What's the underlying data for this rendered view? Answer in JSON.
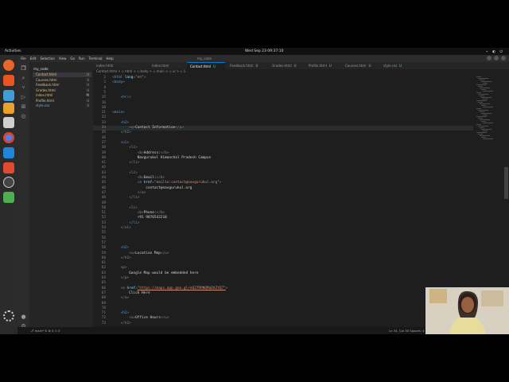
{
  "topbar": {
    "activities": "Activities",
    "clock": "Wed Sep 23  09:37:10",
    "tray": "⌁ ◐ ⏻"
  },
  "menu": [
    "File",
    "Edit",
    "Selection",
    "View",
    "Go",
    "Run",
    "Terminal",
    "Help"
  ],
  "window_title": "my_code",
  "explorer": {
    "title": "my_code",
    "files": [
      {
        "name": "Contact.html",
        "badge": "U",
        "active": true
      },
      {
        "name": "Courses.html",
        "badge": "U",
        "active": false
      },
      {
        "name": "Feedback.html",
        "badge": "U",
        "active": false
      },
      {
        "name": "Grades.html",
        "badge": "U",
        "active": false
      },
      {
        "name": "index.html",
        "badge": "M",
        "active": false
      },
      {
        "name": "Profile.html",
        "badge": "U",
        "active": false
      },
      {
        "name": "style.css",
        "badge": "U",
        "active": false
      }
    ]
  },
  "tabs": [
    {
      "label": "index.html",
      "badge": "",
      "active": false
    },
    {
      "label": "index.html",
      "badge": "",
      "active": false
    },
    {
      "label": "Contact.html",
      "badge": "U",
      "active": true
    },
    {
      "label": "Feedback.html",
      "badge": "U",
      "active": false
    },
    {
      "label": "Grades.html",
      "badge": "U",
      "active": false
    },
    {
      "label": "Profile.html",
      "badge": "U",
      "active": false
    },
    {
      "label": "Courses.html",
      "badge": "U",
      "active": false
    },
    {
      "label": "style.css",
      "badge": "U",
      "active": false
    }
  ],
  "breadcrumb": "Contact.html > ◇ html > ◇ body > ◇ main > ◇ ul > ◇ li",
  "editor": {
    "lines": [
      {
        "n": "2",
        "parts": [
          [
            "punct",
            "<"
          ],
          [
            "tag",
            "html"
          ],
          [
            "attr",
            " lang"
          ],
          [
            "punct",
            "="
          ],
          [
            "str",
            "\"en\""
          ],
          [
            "punct",
            ">"
          ]
        ]
      },
      {
        "n": "3",
        "parts": [
          [
            "punct",
            "<"
          ],
          [
            "tag",
            "body"
          ],
          [
            "punct",
            ">"
          ]
        ]
      },
      {
        "n": "4",
        "parts": []
      },
      {
        "n": "5",
        "parts": []
      },
      {
        "n": "15",
        "parts": [
          [
            "text",
            "    "
          ],
          [
            "punct",
            "<"
          ],
          [
            "tag",
            "hr"
          ],
          [
            "punct",
            "/>"
          ]
        ]
      },
      {
        "n": "16",
        "parts": []
      },
      {
        "n": "30",
        "parts": []
      },
      {
        "n": "31",
        "parts": [
          [
            "punct",
            "<"
          ],
          [
            "tag",
            "main"
          ],
          [
            "punct",
            ">"
          ]
        ]
      },
      {
        "n": "32",
        "parts": []
      },
      {
        "n": "33",
        "parts": [
          [
            "text",
            "    "
          ],
          [
            "punct",
            "<"
          ],
          [
            "tag",
            "h2"
          ],
          [
            "punct",
            ">"
          ]
        ]
      },
      {
        "n": "34",
        "parts": [
          [
            "text",
            "        "
          ],
          [
            "punct",
            "<"
          ],
          [
            "tag",
            "u"
          ],
          [
            "punct",
            ">"
          ],
          [
            "text",
            "Contact Information"
          ],
          [
            "punct",
            "</"
          ],
          [
            "tag",
            "u"
          ],
          [
            "punct",
            ">"
          ]
        ],
        "hl": true
      },
      {
        "n": "35",
        "parts": [
          [
            "text",
            "    "
          ],
          [
            "punct",
            "</"
          ],
          [
            "tag",
            "h2"
          ],
          [
            "punct",
            ">"
          ]
        ]
      },
      {
        "n": "36",
        "parts": []
      },
      {
        "n": "37",
        "parts": [
          [
            "text",
            "    "
          ],
          [
            "punct",
            "<"
          ],
          [
            "tag",
            "ul"
          ],
          [
            "punct",
            ">"
          ]
        ]
      },
      {
        "n": "38",
        "parts": [
          [
            "text",
            "        "
          ],
          [
            "punct",
            "<"
          ],
          [
            "tag",
            "li"
          ],
          [
            "punct",
            ">"
          ]
        ]
      },
      {
        "n": "39",
        "parts": [
          [
            "text",
            "            "
          ],
          [
            "punct",
            "<"
          ],
          [
            "tag",
            "b"
          ],
          [
            "punct",
            ">"
          ],
          [
            "text",
            "Address:"
          ],
          [
            "punct",
            "</"
          ],
          [
            "tag",
            "b"
          ],
          [
            "punct",
            ">"
          ]
        ]
      },
      {
        "n": "40",
        "parts": [
          [
            "text",
            "            Navgurukul Himanchal Pradesh Campus"
          ]
        ]
      },
      {
        "n": "41",
        "parts": [
          [
            "text",
            "        "
          ],
          [
            "punct",
            "</"
          ],
          [
            "tag",
            "li"
          ],
          [
            "punct",
            ">"
          ]
        ]
      },
      {
        "n": "42",
        "parts": []
      },
      {
        "n": "43",
        "parts": [
          [
            "text",
            "        "
          ],
          [
            "punct",
            "<"
          ],
          [
            "tag",
            "li"
          ],
          [
            "punct",
            ">"
          ]
        ]
      },
      {
        "n": "44",
        "parts": [
          [
            "text",
            "            "
          ],
          [
            "punct",
            "<"
          ],
          [
            "tag",
            "b"
          ],
          [
            "punct",
            ">"
          ],
          [
            "text",
            "Email:"
          ],
          [
            "punct",
            "</"
          ],
          [
            "tag",
            "b"
          ],
          [
            "punct",
            ">"
          ]
        ]
      },
      {
        "n": "45",
        "parts": [
          [
            "text",
            "            "
          ],
          [
            "punct",
            "<"
          ],
          [
            "tag",
            "a"
          ],
          [
            "attr",
            " href"
          ],
          [
            "punct",
            "="
          ],
          [
            "str",
            "\"mailto:contact@navgurukul.org\""
          ],
          [
            "punct",
            ">"
          ]
        ]
      },
      {
        "n": "46",
        "parts": [
          [
            "text",
            "                contact@navgurukul.org"
          ]
        ]
      },
      {
        "n": "47",
        "parts": [
          [
            "text",
            "            "
          ],
          [
            "punct",
            "</"
          ],
          [
            "tag",
            "a"
          ],
          [
            "punct",
            ">"
          ]
        ]
      },
      {
        "n": "48",
        "parts": [
          [
            "text",
            "        "
          ],
          [
            "punct",
            "</"
          ],
          [
            "tag",
            "li"
          ],
          [
            "punct",
            ">"
          ]
        ]
      },
      {
        "n": "49",
        "parts": []
      },
      {
        "n": "50",
        "parts": [
          [
            "text",
            "        "
          ],
          [
            "punct",
            "<"
          ],
          [
            "tag",
            "li"
          ],
          [
            "punct",
            ">"
          ]
        ]
      },
      {
        "n": "51",
        "parts": [
          [
            "text",
            "            "
          ],
          [
            "punct",
            "<"
          ],
          [
            "tag",
            "b"
          ],
          [
            "punct",
            ">"
          ],
          [
            "text",
            "Phone:"
          ],
          [
            "punct",
            "</"
          ],
          [
            "tag",
            "b"
          ],
          [
            "punct",
            ">"
          ]
        ]
      },
      {
        "n": "52",
        "parts": [
          [
            "text",
            "            +91 9876543210"
          ]
        ]
      },
      {
        "n": "53",
        "parts": [
          [
            "text",
            "        "
          ],
          [
            "punct",
            "</"
          ],
          [
            "tag",
            "li"
          ],
          [
            "punct",
            ">"
          ]
        ]
      },
      {
        "n": "54",
        "parts": [
          [
            "text",
            "    "
          ],
          [
            "punct",
            "</"
          ],
          [
            "tag",
            "ul"
          ],
          [
            "punct",
            ">"
          ]
        ]
      },
      {
        "n": "55",
        "parts": []
      },
      {
        "n": "56",
        "parts": []
      },
      {
        "n": "57",
        "parts": []
      },
      {
        "n": "58",
        "parts": [
          [
            "text",
            "    "
          ],
          [
            "punct",
            "<"
          ],
          [
            "tag",
            "h2"
          ],
          [
            "punct",
            ">"
          ]
        ]
      },
      {
        "n": "59",
        "parts": [
          [
            "text",
            "        "
          ],
          [
            "punct",
            "<"
          ],
          [
            "tag",
            "u"
          ],
          [
            "punct",
            ">"
          ],
          [
            "text",
            "Location Map"
          ],
          [
            "punct",
            "</"
          ],
          [
            "tag",
            "u"
          ],
          [
            "punct",
            ">"
          ]
        ]
      },
      {
        "n": "60",
        "parts": [
          [
            "text",
            "    "
          ],
          [
            "punct",
            "</"
          ],
          [
            "tag",
            "h2"
          ],
          [
            "punct",
            ">"
          ]
        ]
      },
      {
        "n": "61",
        "parts": []
      },
      {
        "n": "62",
        "parts": [
          [
            "text",
            "    "
          ],
          [
            "punct",
            "<"
          ],
          [
            "tag",
            "p"
          ],
          [
            "punct",
            ">"
          ]
        ]
      },
      {
        "n": "63",
        "parts": [
          [
            "text",
            "        Google Map would be embedded here"
          ]
        ]
      },
      {
        "n": "64",
        "parts": [
          [
            "text",
            "    "
          ],
          [
            "punct",
            "</"
          ],
          [
            "tag",
            "p"
          ],
          [
            "punct",
            ">"
          ]
        ]
      },
      {
        "n": "65",
        "parts": []
      },
      {
        "n": "66",
        "parts": [
          [
            "text",
            "    "
          ],
          [
            "punct",
            "<"
          ],
          [
            "tag",
            "a"
          ],
          [
            "attr",
            " href"
          ],
          [
            "punct",
            "="
          ],
          [
            "link",
            "\"https://maps.app.goo.gl/eQ27RRNQMuD4ZYQ7\""
          ],
          [
            "punct",
            ">"
          ]
        ]
      },
      {
        "n": "67",
        "parts": [
          [
            "text",
            "        Click Here"
          ]
        ]
      },
      {
        "n": "68",
        "parts": [
          [
            "text",
            "    "
          ],
          [
            "punct",
            "</"
          ],
          [
            "tag",
            "a"
          ],
          [
            "punct",
            ">"
          ]
        ]
      },
      {
        "n": "69",
        "parts": []
      },
      {
        "n": "70",
        "parts": []
      },
      {
        "n": "71",
        "parts": [
          [
            "text",
            "    "
          ],
          [
            "punct",
            "<"
          ],
          [
            "tag",
            "h2"
          ],
          [
            "punct",
            ">"
          ]
        ]
      },
      {
        "n": "72",
        "parts": [
          [
            "text",
            "        "
          ],
          [
            "punct",
            "<"
          ],
          [
            "tag",
            "u"
          ],
          [
            "punct",
            ">"
          ],
          [
            "text",
            "Office Hours"
          ],
          [
            "punct",
            "</"
          ],
          [
            "tag",
            "u"
          ],
          [
            "punct",
            ">"
          ]
        ]
      },
      {
        "n": "73",
        "parts": [
          [
            "text",
            "    "
          ],
          [
            "punct",
            "</"
          ],
          [
            "tag",
            "h2"
          ],
          [
            "punct",
            ">"
          ]
        ]
      }
    ]
  },
  "statusbar": {
    "left": "⎇ main* ↻ ⊗ 0 ⚠ 0",
    "right": "Ln 34, Col 30   Spaces: 4   UTF-8   LF   HTML"
  },
  "colors": {
    "accent": "#007acc",
    "untracked": "#73c991",
    "editor_bg": "#1e1e1e"
  }
}
